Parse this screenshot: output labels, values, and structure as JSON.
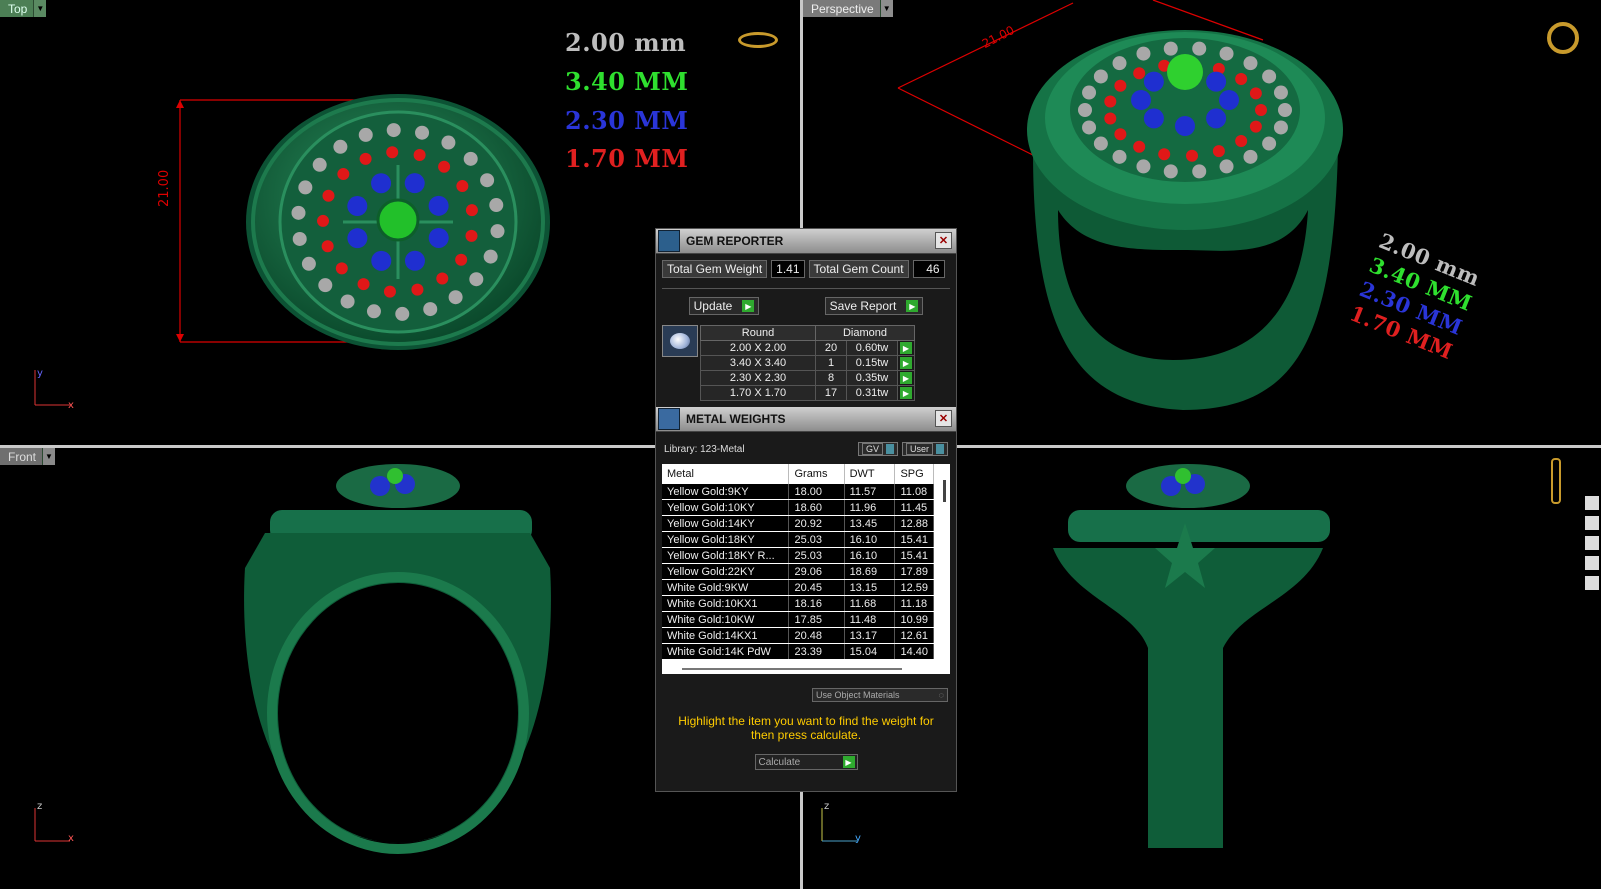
{
  "viewports": {
    "top": {
      "label": "Top"
    },
    "perspective": {
      "label": "Perspective"
    },
    "front": {
      "label": "Front"
    }
  },
  "dimensions": {
    "top_height": "21.00",
    "persp_diag": "21.00"
  },
  "legend": [
    "2.00 mm",
    "3.40 MM",
    "2.30 MM",
    "1.70 MM"
  ],
  "legend_colors": [
    "#bdbdbd",
    "#2fe02f",
    "#2a35d8",
    "#e02020"
  ],
  "axes": {
    "top": {
      "v": "y",
      "h": "x"
    },
    "front": {
      "v": "z",
      "h": "x"
    },
    "side": {
      "v": "z",
      "h": "y"
    }
  },
  "gem_reporter": {
    "title": "GEM REPORTER",
    "total_weight_label": "Total Gem Weight",
    "total_weight": "1.41",
    "total_count_label": "Total Gem Count",
    "total_count": "46",
    "update_label": "Update",
    "save_label": "Save Report",
    "headers": [
      "Round",
      "Diamond"
    ],
    "rows": [
      {
        "size": "2.00 X 2.00",
        "count": "20",
        "tw": "0.60tw"
      },
      {
        "size": "3.40 X 3.40",
        "count": "1",
        "tw": "0.15tw"
      },
      {
        "size": "2.30 X 2.30",
        "count": "8",
        "tw": "0.35tw"
      },
      {
        "size": "1.70 X 1.70",
        "count": "17",
        "tw": "0.31tw"
      }
    ]
  },
  "metal_weights": {
    "title": "METAL WEIGHTS",
    "library": "Library: 123-Metal",
    "toggle_gv": "GV",
    "toggle_user": "User",
    "columns": [
      "Metal",
      "Grams",
      "DWT",
      "SPG"
    ],
    "rows": [
      [
        "Yellow Gold:9KY",
        "18.00",
        "11.57",
        "11.08"
      ],
      [
        "Yellow Gold:10KY",
        "18.60",
        "11.96",
        "11.45"
      ],
      [
        "Yellow Gold:14KY",
        "20.92",
        "13.45",
        "12.88"
      ],
      [
        "Yellow Gold:18KY",
        "25.03",
        "16.10",
        "15.41"
      ],
      [
        "Yellow Gold:18KY R...",
        "25.03",
        "16.10",
        "15.41"
      ],
      [
        "Yellow Gold:22KY",
        "29.06",
        "18.69",
        "17.89"
      ],
      [
        "White Gold:9KW",
        "20.45",
        "13.15",
        "12.59"
      ],
      [
        "White Gold:10KX1",
        "18.16",
        "11.68",
        "11.18"
      ],
      [
        "White Gold:10KW",
        "17.85",
        "11.48",
        "10.99"
      ],
      [
        "White Gold:14KX1",
        "20.48",
        "13.17",
        "12.61"
      ],
      [
        "White Gold:14K PdW",
        "23.39",
        "15.04",
        "14.40"
      ]
    ],
    "use_object_materials": "Use Object Materials",
    "hint": "Highlight the item you want to find the weight for then press calculate.",
    "calculate_label": "Calculate"
  }
}
